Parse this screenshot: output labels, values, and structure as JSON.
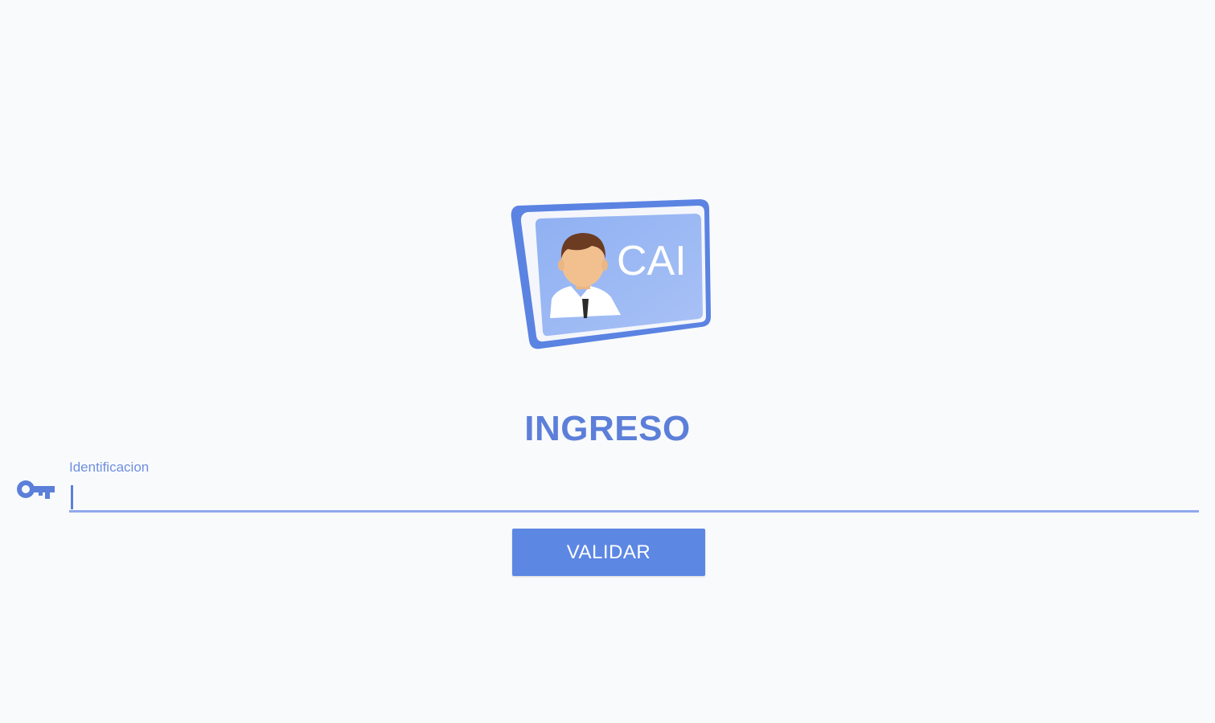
{
  "logo": {
    "icon": "cai-id-card-logo",
    "text": "CAI",
    "colors": {
      "frame": "#5b83e2",
      "card": "#9cb7f2",
      "skin": "#f2c08f",
      "hair": "#6b3b22"
    }
  },
  "login": {
    "title": "INGRESO",
    "field_label": "Identificacion",
    "field_value": "",
    "key_icon": "key-icon",
    "button_label": "VALIDAR"
  },
  "colors": {
    "accent": "#5c87e3",
    "title": "#5c7fd9",
    "underline": "#8fa9ec",
    "background": "#f9fafb"
  }
}
